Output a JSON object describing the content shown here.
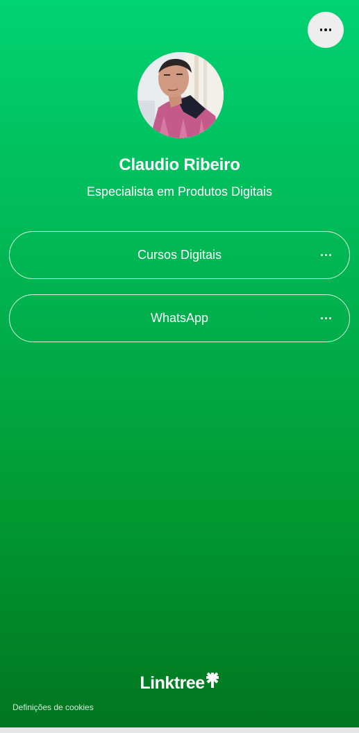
{
  "profile": {
    "name": "Claudio Ribeiro",
    "bio": "Especialista em Produtos Digitais"
  },
  "links": [
    {
      "label": "Cursos Digitais"
    },
    {
      "label": "WhatsApp"
    }
  ],
  "footer": {
    "logo_text": "Linktree",
    "cookie_settings": "Definições de cookies"
  },
  "colors": {
    "background_top": "#01d273",
    "background_bottom": "#017620",
    "text": "#ffffff",
    "menu_button_bg": "#eeeeee"
  },
  "icons": {
    "menu": "more-horizontal-icon",
    "link_more": "more-horizontal-icon",
    "logo_mark": "linktree-asterisk-icon"
  }
}
